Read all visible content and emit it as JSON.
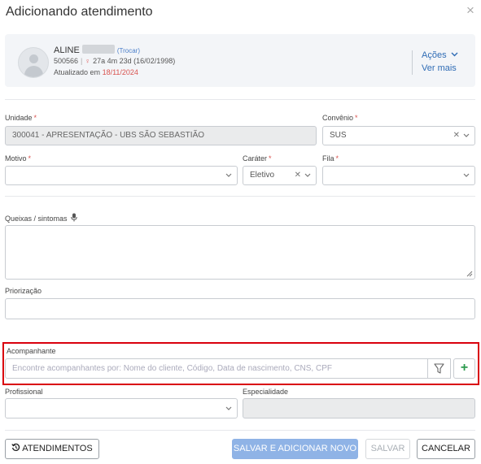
{
  "dialog": {
    "title": "Adicionando atendimento",
    "close_symbol": "×"
  },
  "patient": {
    "name": "ALINE",
    "change_link": "(Trocar)",
    "code": "500566",
    "age": "27a 4m 23d (16/02/1998)",
    "updated_prefix": "Atualizado em",
    "updated_date": "18/11/2024",
    "actions_label": "Ações",
    "see_more_label": "Ver mais"
  },
  "form": {
    "unidade": {
      "label": "Unidade",
      "value": "300041 - APRESENTAÇÃO - UBS SÃO SEBASTIÃO"
    },
    "convenio": {
      "label": "Convênio",
      "value": "SUS"
    },
    "motivo": {
      "label": "Motivo",
      "value": ""
    },
    "carater": {
      "label": "Caráter",
      "value": "Eletivo"
    },
    "fila": {
      "label": "Fila",
      "value": ""
    },
    "queixas": {
      "label": "Queixas / sintomas"
    },
    "priorizacao": {
      "label": "Priorização",
      "value": ""
    },
    "acompanhante": {
      "label": "Acompanhante",
      "placeholder": "Encontre acompanhantes por: Nome do cliente, Código, Data de nascimento, CNS, CPF"
    },
    "profissional": {
      "label": "Profissional",
      "value": ""
    },
    "especialidade": {
      "label": "Especialidade",
      "value": ""
    },
    "required_mark": "*"
  },
  "footer": {
    "atendimentos": "ATENDIMENTOS",
    "save_add_new": "SALVAR E ADICIONAR NOVO",
    "save": "SALVAR",
    "cancel": "CANCELAR"
  },
  "colors": {
    "accent": "#2f6cb5",
    "highlight_border": "#d9000d",
    "required": "#d9534f",
    "primary_button": "#8fb3e6",
    "add_icon": "#2e9b4f"
  }
}
